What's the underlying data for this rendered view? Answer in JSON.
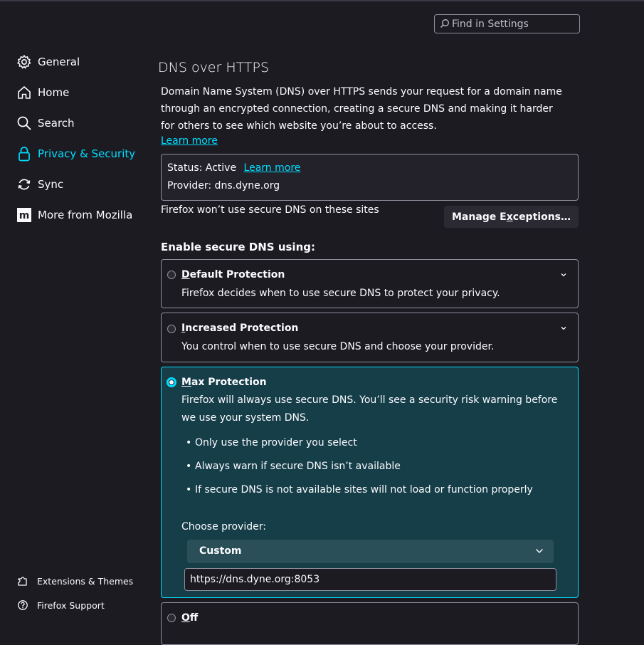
{
  "search": {
    "placeholder": "Find in Settings"
  },
  "sidebar": {
    "items": [
      {
        "label": "General",
        "icon": "gear-icon"
      },
      {
        "label": "Home",
        "icon": "home-icon"
      },
      {
        "label": "Search",
        "icon": "search-icon"
      },
      {
        "label": "Privacy & Security",
        "icon": "lock-icon",
        "active": true
      },
      {
        "label": "Sync",
        "icon": "sync-icon"
      },
      {
        "label": "More from Mozilla",
        "icon": "mozilla-icon"
      }
    ],
    "footer": [
      {
        "label": "Extensions & Themes",
        "icon": "puzzle-icon"
      },
      {
        "label": "Firefox Support",
        "icon": "help-icon"
      }
    ]
  },
  "section": {
    "title": "DNS over HTTPS",
    "description": "Domain Name System (DNS) over HTTPS sends your request for a domain name through an encrypted connection, creating a secure DNS and making it harder for others to see which website you’re about to access.",
    "learn_more": "Learn more"
  },
  "status": {
    "status_text": "Status: Active",
    "learn_more": "Learn more",
    "provider_text": "Provider: dns.dyne.org"
  },
  "exceptions": {
    "text": "Firefox won’t use secure DNS on these sites",
    "button_pre": "Manage E",
    "button_key": "x",
    "button_post": "ceptions…"
  },
  "enable_heading": "Enable secure DNS using:",
  "options": {
    "default": {
      "key": "D",
      "rest": "efault Protection",
      "desc": "Firefox decides when to use secure DNS to protect your privacy."
    },
    "increased": {
      "key": "I",
      "rest": "ncreased Protection",
      "desc": "You control when to use secure DNS and choose your provider."
    },
    "max": {
      "key": "M",
      "rest": "ax Protection",
      "desc": "Firefox will always use secure DNS. You’ll see a security risk warning before we use your system DNS.",
      "bullets": [
        "Only use the provider you select",
        "Always warn if secure DNS isn’t available",
        "If secure DNS is not available sites will not load or function properly"
      ],
      "provider_label": "Choose provider:",
      "provider_value": "Custom",
      "custom_url": "https://dns.dyne.org:8053"
    },
    "off": {
      "key": "O",
      "rest": "ff"
    }
  },
  "colors": {
    "accent": "#00ddff",
    "background": "#1c1b22",
    "selected_card": "#163e49"
  }
}
